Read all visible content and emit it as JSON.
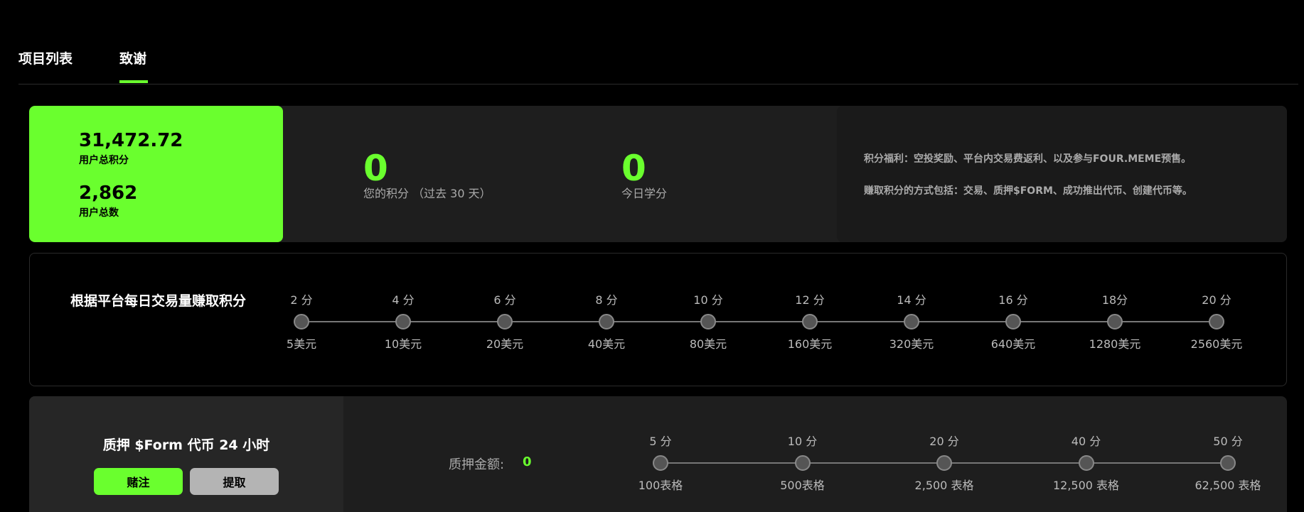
{
  "tabs": [
    {
      "label": "项目列表"
    },
    {
      "label": "致谢"
    }
  ],
  "summary": {
    "total_points": "31,472.72",
    "total_points_label": "用户总积分",
    "total_users": "2,862",
    "total_users_label": "用户总数",
    "your_points": "0",
    "your_points_label": "您的积分 （过去 30 天）",
    "today_points": "0",
    "today_points_label": "今日学分"
  },
  "info": {
    "line1": "积分福利：空投奖励、平台内交易费返利、以及参与FOUR.MEME预售。",
    "line2": "赚取积分的方式包括：交易、质押$FORM、成功推出代币、创建代币等。"
  },
  "volume_section": {
    "title": "根据平台每日交易量赚取积分",
    "tiers": [
      {
        "points": "2 分",
        "amount": "5美元"
      },
      {
        "points": "4 分",
        "amount": "10美元"
      },
      {
        "points": "6 分",
        "amount": "20美元"
      },
      {
        "points": "8 分",
        "amount": "40美元"
      },
      {
        "points": "10 分",
        "amount": "80美元"
      },
      {
        "points": "12 分",
        "amount": "160美元"
      },
      {
        "points": "14 分",
        "amount": "320美元"
      },
      {
        "points": "16 分",
        "amount": "640美元"
      },
      {
        "points": "18分",
        "amount": "1280美元"
      },
      {
        "points": "20 分",
        "amount": "2560美元"
      }
    ]
  },
  "stake_section": {
    "title": "质押 $Form 代币 24 小时",
    "bet_label": "赌注",
    "withdraw_label": "提取",
    "amount_label": "质押金额:",
    "amount_value": "0",
    "tiers": [
      {
        "points": "5 分",
        "amount": "100表格"
      },
      {
        "points": "10 分",
        "amount": "500表格"
      },
      {
        "points": "20 分",
        "amount": "2,500 表格"
      },
      {
        "points": "40 分",
        "amount": "12,500 表格"
      },
      {
        "points": "50 分",
        "amount": "62,500 表格"
      }
    ]
  },
  "colors": {
    "accent": "#6aff2e",
    "background": "#000000",
    "card": "#1e1e1e"
  }
}
